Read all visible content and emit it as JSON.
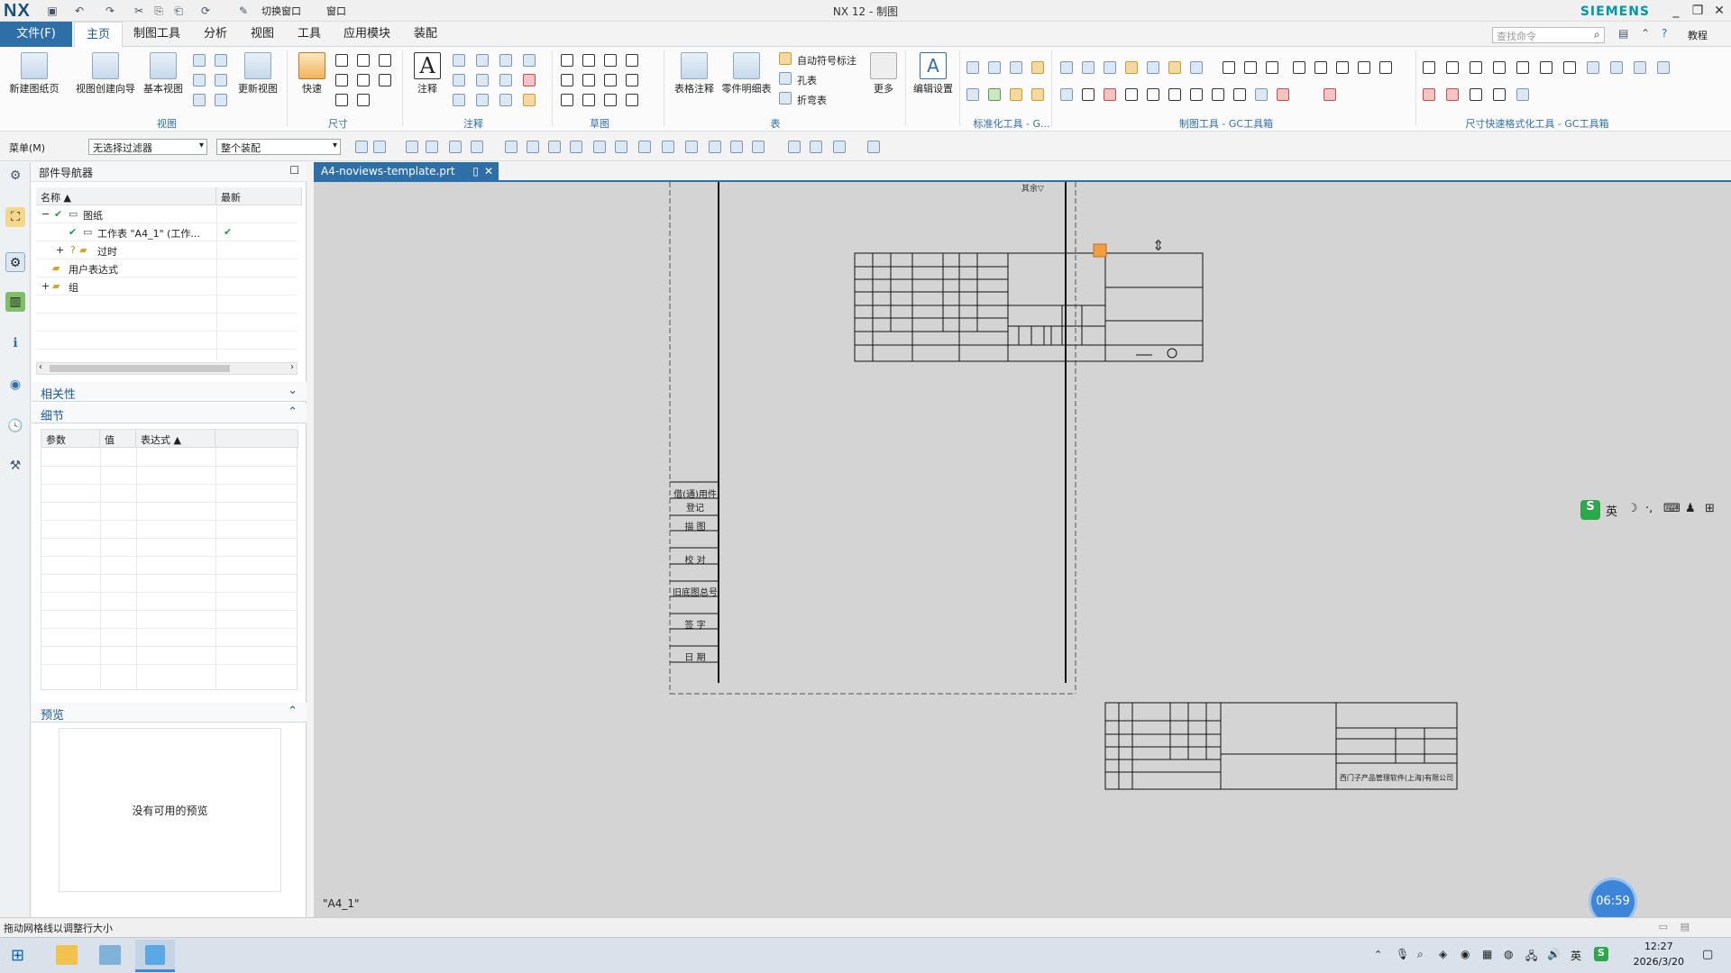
{
  "app": {
    "logo": "NX",
    "window_title": "NX 12 - 制图",
    "brand": "SIEMENS",
    "quick_access": {
      "switch_window": "切换窗口",
      "window_menu": "窗口"
    }
  },
  "menu_tabs": {
    "file": "文件(F)",
    "items": [
      "主页",
      "制图工具",
      "分析",
      "视图",
      "工具",
      "应用模块",
      "装配"
    ],
    "active": "主页"
  },
  "command_search_placeholder": "查找命令",
  "help_label": "教程",
  "ribbon": {
    "view_group": {
      "label": "视图",
      "new_sheet": "新建图纸页",
      "view_wizard": "视图创建向导",
      "base_view": "基本视图",
      "update_view": "更新视图"
    },
    "dimension_group": {
      "label": "尺寸",
      "rapid": "快速"
    },
    "annotation_group": {
      "label": "注释",
      "note": "注释"
    },
    "sketch_group": {
      "label": "草图"
    },
    "table_group": {
      "label": "表",
      "tabular_note": "表格注释",
      "parts_list": "零件明细表",
      "auto_balloon": "自动符号标注",
      "hole_table": "孔表",
      "bend_table": "折弯表",
      "more": "更多"
    },
    "edit_settings": "编辑设置",
    "std_tools_group": "标准化工具 - G...",
    "gc_drafting_group": "制图工具 - GC工具箱",
    "gc_dim_group": "尺寸快速格式化工具 - GC工具箱"
  },
  "toolbar2": {
    "menu": "菜单(M)",
    "filter": "无选择过滤器",
    "scope": "整个装配"
  },
  "navigator": {
    "title": "部件导航器",
    "columns": [
      "名称",
      "最新"
    ],
    "tree": [
      {
        "label": "图纸",
        "level": 0,
        "expand": "−"
      },
      {
        "label": "工作表 \"A4_1\" (工作...",
        "level": 1,
        "expand": "",
        "latest": "✔"
      },
      {
        "label": "过时",
        "level": 1,
        "expand": "+"
      },
      {
        "label": "用户表达式",
        "level": 0,
        "expand": ""
      },
      {
        "label": "组",
        "level": 0,
        "expand": "+"
      }
    ],
    "dependency": "相关性",
    "details": "细节",
    "details_columns": [
      "参数",
      "值",
      "表达式"
    ],
    "preview": "预览",
    "preview_empty": "没有可用的预览"
  },
  "document_tab": "A4-noviews-template.prt",
  "sheet_label": "\"A4_1\"",
  "drawing": {
    "side_labels": [
      "借(通)用件登记",
      "描 图",
      "校 对",
      "旧底图总号",
      "签 字",
      "日 期"
    ],
    "ime": "英",
    "company": "西门子产品管理软件(上海)有限公司"
  },
  "status_text": "拖动网格线以调整行大小",
  "timer": "06:59",
  "clock": {
    "time": "12:27",
    "date": "2026/3/20"
  },
  "tray_lang": "英"
}
